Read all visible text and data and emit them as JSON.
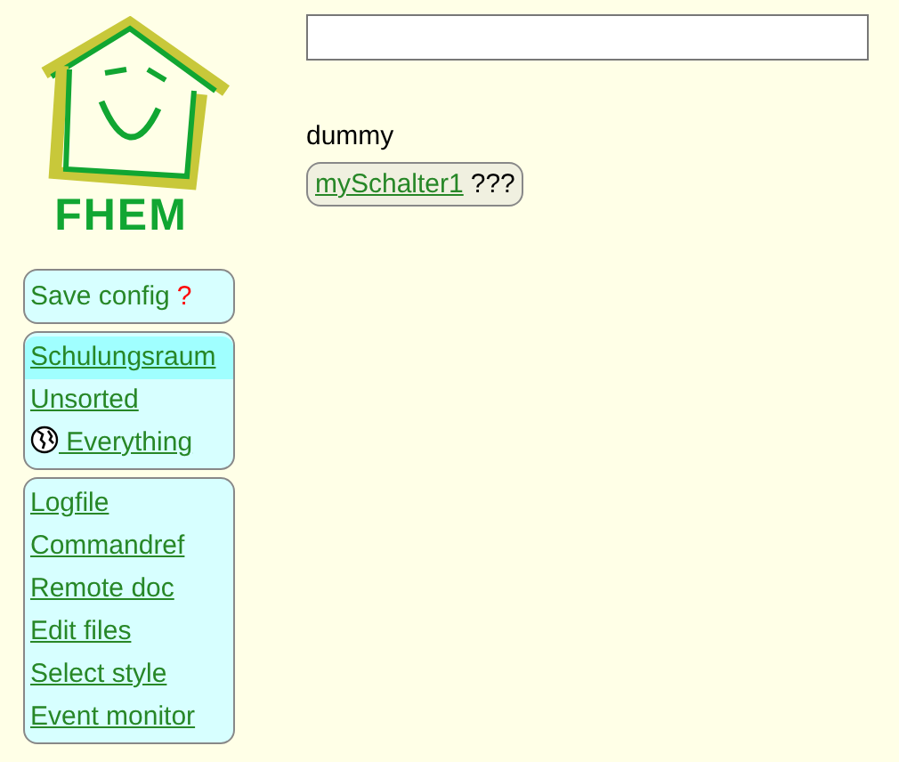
{
  "logo": {
    "text": "FHEM"
  },
  "save_config": {
    "label": "Save config",
    "indicator": "?"
  },
  "rooms": [
    {
      "label": "Schulungsraum",
      "selected": true,
      "kind": "link"
    },
    {
      "label": "Unsorted",
      "selected": false,
      "kind": "link"
    },
    {
      "label": " Everything",
      "selected": false,
      "kind": "globe"
    }
  ],
  "menu": [
    "Logfile",
    "Commandref",
    "Remote doc",
    "Edit files",
    "Select style",
    "Event monitor"
  ],
  "group": {
    "title": "dummy",
    "devices": [
      {
        "name": "mySchalter1",
        "state": "???"
      }
    ]
  }
}
